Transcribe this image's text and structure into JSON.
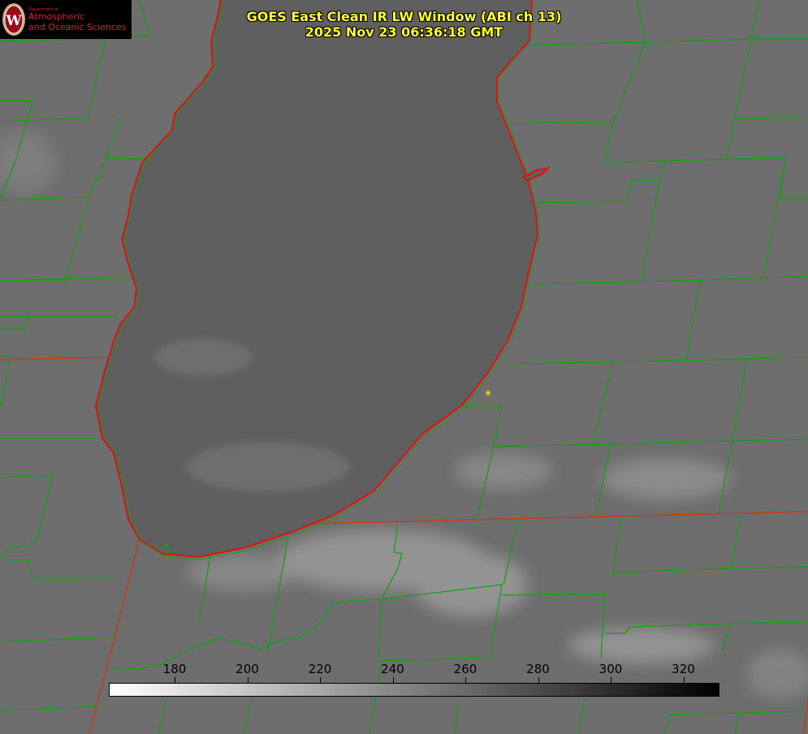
{
  "title": {
    "line1": "GOES East Clean IR LW Window (ABI ch 13)",
    "line2": "2025 Nov 23 06:36:18 GMT"
  },
  "logo": {
    "dept": "Department of",
    "line1": "Atmospheric",
    "line2": "and Oceanic Sciences",
    "seal_letter": "W"
  },
  "colorbar": {
    "ticks": [
      "180",
      "200",
      "220",
      "240",
      "260",
      "280",
      "300",
      "320"
    ],
    "gradient_from": "#ffffff",
    "gradient_to": "#000000"
  },
  "colors": {
    "land": "#6e6e6e",
    "lake": "#5f5f5f",
    "cloud": "#9a9a9a",
    "county_lines": "#12a012",
    "coast_lines": "#e01010",
    "state_lines": "#c0401a",
    "marker": "#d8c000",
    "title_text": "#ffff33"
  },
  "icons": {
    "logo_seal": "uw-madison-seal-icon",
    "marker": "station-marker-icon"
  }
}
